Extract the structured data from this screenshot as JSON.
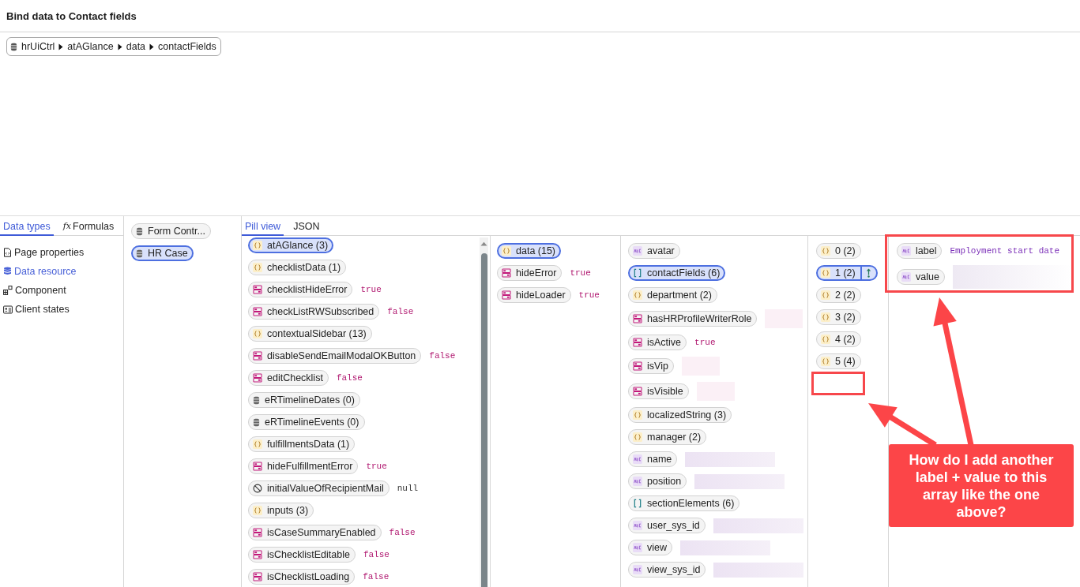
{
  "title": "Bind data to Contact fields",
  "breadcrumb": [
    "hrUiCtrl",
    "atAGlance",
    "data",
    "contactFields"
  ],
  "left_panel": {
    "tabs": [
      {
        "label": "Data types",
        "selected": true
      },
      {
        "label": "Formulas",
        "selected": false,
        "icon_text": "fx"
      }
    ],
    "items": [
      {
        "label": "Page properties",
        "kind": "page",
        "selected": false
      },
      {
        "label": "Data resource",
        "kind": "data",
        "selected": true
      },
      {
        "label": "Component",
        "kind": "component",
        "selected": false
      },
      {
        "label": "Client states",
        "kind": "client_state",
        "selected": false
      }
    ]
  },
  "sources": [
    {
      "label": "Form Contr...",
      "selected": false
    },
    {
      "label": "HR Case",
      "selected": true
    }
  ],
  "view_tabs": [
    {
      "label": "Pill view",
      "selected": true
    },
    {
      "label": "JSON",
      "selected": false
    }
  ],
  "columns": [
    {
      "items": [
        {
          "label": "atAGlance (3)",
          "kind": "object",
          "selected": true
        },
        {
          "label": "checklistData (1)",
          "kind": "object",
          "selected": false
        },
        {
          "label": "checklistHideError",
          "kind": "boolean",
          "selected": false,
          "value": "true"
        },
        {
          "label": "checkListRWSubscribed",
          "kind": "boolean",
          "selected": false,
          "value": "false"
        },
        {
          "label": "contextualSidebar (13)",
          "kind": "object",
          "selected": false
        },
        {
          "label": "disableSendEmailModalOKButton",
          "kind": "boolean",
          "selected": false,
          "value": "false"
        },
        {
          "label": "editChecklist",
          "kind": "boolean",
          "selected": false,
          "value": "false"
        },
        {
          "label": "eRTimelineDates (0)",
          "kind": "table",
          "selected": false
        },
        {
          "label": "eRTimelineEvents (0)",
          "kind": "table",
          "selected": false
        },
        {
          "label": "fulfillmentsData (1)",
          "kind": "object",
          "selected": false
        },
        {
          "label": "hideFulfillmentError",
          "kind": "boolean",
          "selected": false,
          "value": "true"
        },
        {
          "label": "initialValueOfRecipientMail",
          "kind": "null",
          "selected": false,
          "value": "null"
        },
        {
          "label": "inputs (3)",
          "kind": "object",
          "selected": false
        },
        {
          "label": "isCaseSummaryEnabled",
          "kind": "boolean",
          "selected": false,
          "value": "false"
        },
        {
          "label": "isChecklistEditable",
          "kind": "boolean",
          "selected": false,
          "value": "false"
        },
        {
          "label": "isChecklistLoading",
          "kind": "boolean",
          "selected": false,
          "value": "false"
        }
      ]
    },
    {
      "items": [
        {
          "label": "data (15)",
          "kind": "object",
          "selected": true
        },
        {
          "label": "hideError",
          "kind": "boolean",
          "selected": false,
          "value": "true"
        },
        {
          "label": "hideLoader",
          "kind": "boolean",
          "selected": false,
          "value": "true"
        }
      ]
    },
    {
      "items": [
        {
          "label": "avatar",
          "kind": "string",
          "selected": false,
          "redacted": false
        },
        {
          "label": "contactFields (6)",
          "kind": "array",
          "selected": true,
          "redacted": false
        },
        {
          "label": "department (2)",
          "kind": "object",
          "selected": false,
          "redacted": false
        },
        {
          "label": "hasHRProfileWriterRole",
          "kind": "boolean",
          "selected": false,
          "redacted": true
        },
        {
          "label": "isActive",
          "kind": "boolean",
          "selected": false,
          "value": "true",
          "redacted": false
        },
        {
          "label": "isVip",
          "kind": "boolean",
          "selected": false,
          "redacted": true
        },
        {
          "label": "isVisible",
          "kind": "boolean",
          "selected": false,
          "redacted": true
        },
        {
          "label": "localizedString (3)",
          "kind": "object",
          "selected": false,
          "redacted": false
        },
        {
          "label": "manager (2)",
          "kind": "object",
          "selected": false,
          "redacted": false
        },
        {
          "label": "name",
          "kind": "string",
          "selected": false,
          "redacted": true
        },
        {
          "label": "position",
          "kind": "string",
          "selected": false,
          "redacted": true
        },
        {
          "label": "sectionElements (6)",
          "kind": "array",
          "selected": false,
          "redacted": false
        },
        {
          "label": "user_sys_id",
          "kind": "string",
          "selected": false,
          "redacted": true
        },
        {
          "label": "view",
          "kind": "string",
          "selected": false,
          "redacted": true
        },
        {
          "label": "view_sys_id",
          "kind": "string",
          "selected": false,
          "redacted": true
        }
      ]
    },
    {
      "items": [
        {
          "label": "0 (2)",
          "kind": "object",
          "selected": false,
          "reorder_handle": false
        },
        {
          "label": "1 (2)",
          "kind": "object",
          "selected": true,
          "reorder_handle": true
        },
        {
          "label": "2 (2)",
          "kind": "object",
          "selected": false,
          "reorder_handle": false
        },
        {
          "label": "3 (2)",
          "kind": "object",
          "selected": false,
          "reorder_handle": false
        },
        {
          "label": "4 (2)",
          "kind": "object",
          "selected": false,
          "reorder_handle": false
        },
        {
          "label": "5 (4)",
          "kind": "object",
          "selected": false,
          "reorder_handle": false
        }
      ]
    },
    {
      "items": [
        {
          "label": "label",
          "kind": "string",
          "selected": false,
          "value": "Employment start date",
          "redacted": false
        },
        {
          "label": "value",
          "kind": "string",
          "selected": false,
          "redacted": true
        }
      ]
    }
  ],
  "annotation": {
    "text": "How do I add another label + value to this array like the one above?"
  }
}
